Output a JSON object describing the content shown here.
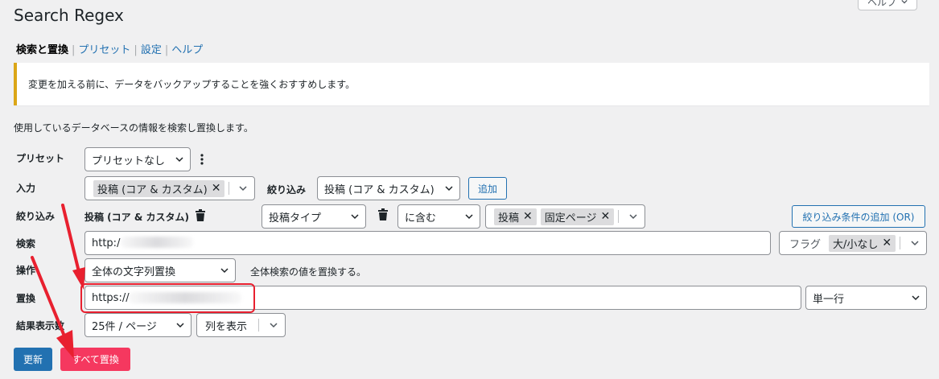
{
  "help_tab": {
    "label": "ヘルプ"
  },
  "page_title": "Search Regex",
  "subnav": {
    "current": "検索と置換",
    "links": [
      "プリセット",
      "設定",
      "ヘルプ"
    ]
  },
  "notice": "変更を加える前に、データをバックアップすることを強くおすすめします。",
  "description": "使用しているデータベースの情報を検索し置換します。",
  "rows": {
    "preset": {
      "label": "プリセット",
      "value": "プリセットなし"
    },
    "source": {
      "label": "入力",
      "chip": "投稿 (コア & カスタム)",
      "filter_label": "絞り込み",
      "filter_value": "投稿 (コア & カスタム)",
      "add_button": "追加"
    },
    "filter": {
      "label": "絞り込み",
      "source_name": "投稿 (コア & カスタム)",
      "column": "投稿タイプ",
      "logic": "に含む",
      "chips": [
        "投稿",
        "固定ページ"
      ],
      "add_button": "絞り込み条件の追加 (OR)"
    },
    "search": {
      "label": "検索",
      "value": "http:/",
      "flags_label": "フラグ",
      "flag_chip": "大/小なし"
    },
    "action": {
      "label": "操作",
      "value": "全体の文字列置換",
      "hint": "全体検索の値を置換する。"
    },
    "replace": {
      "label": "置換",
      "value": "https://",
      "mode": "単一行"
    },
    "results": {
      "label": "結果表示数",
      "per_page": "25件 / ページ",
      "columns": "列を表示"
    }
  },
  "buttons": {
    "update": "更新",
    "replace_all": "すべて置換"
  },
  "colors": {
    "accent": "#2271b1",
    "danger": "#f5385f",
    "notice_border": "#dba617",
    "annotation": "#e8202f"
  }
}
